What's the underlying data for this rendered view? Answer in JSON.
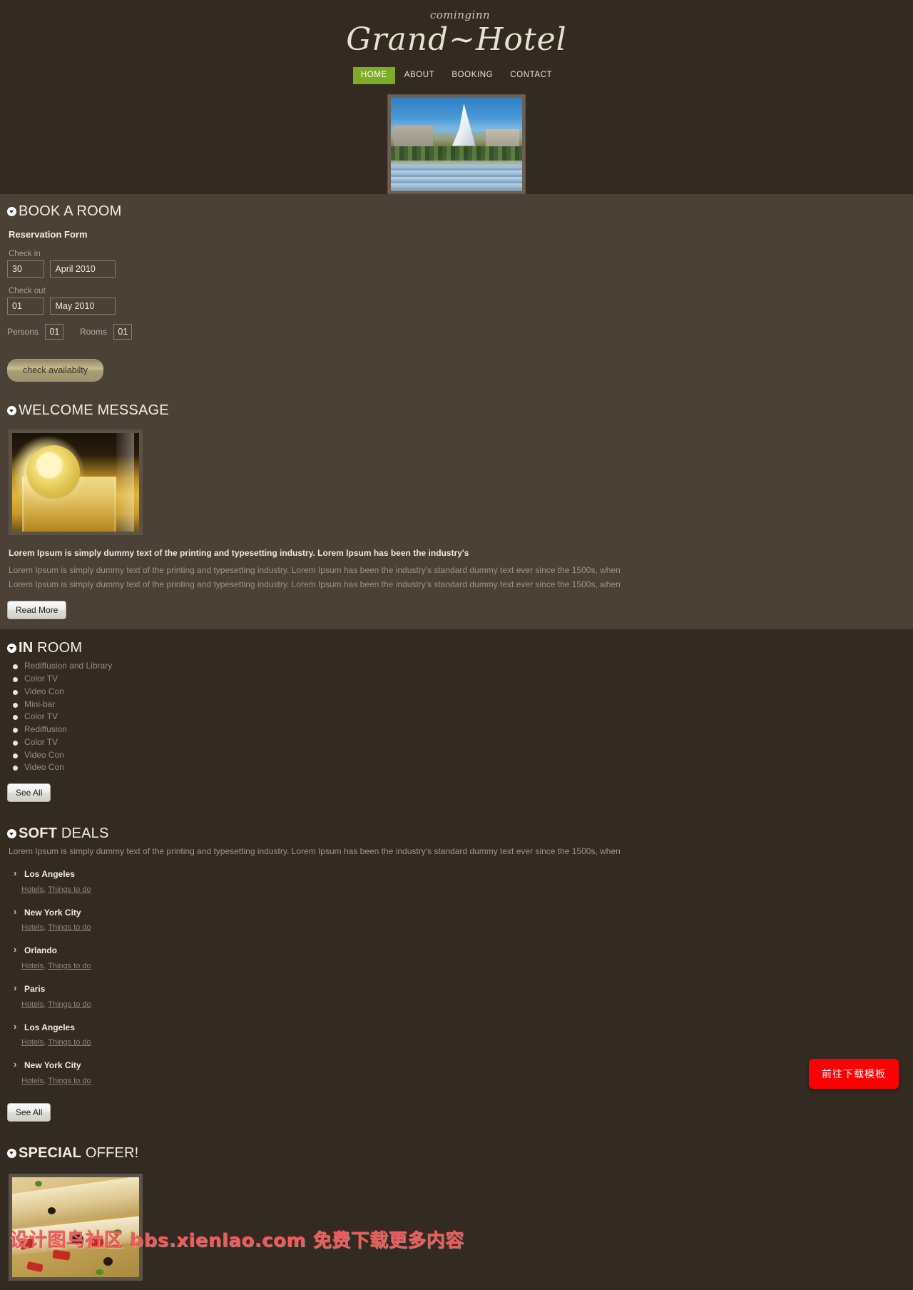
{
  "header": {
    "logo_sub": "cominginn",
    "logo_main": "Grand~Hotel",
    "hero_icon": "hotel-photo"
  },
  "nav": {
    "items": [
      {
        "label": "HOME",
        "active": true
      },
      {
        "label": "ABOUT",
        "active": false
      },
      {
        "label": "BOOKING",
        "active": false
      },
      {
        "label": "CONTACT",
        "active": false
      }
    ]
  },
  "book": {
    "title": "BOOK A ROOM",
    "form_title": "Reservation Form",
    "checkin_label": "Check in",
    "checkin_day": "30",
    "checkin_month": "April 2010",
    "checkout_label": "Check out",
    "checkout_day": "01",
    "checkout_month": "May 2010",
    "persons_label": "Persons",
    "persons_value": "01",
    "rooms_label": "Rooms",
    "rooms_value": "01",
    "submit_label": "check availabilty"
  },
  "welcome": {
    "title": "WELCOME MESSAGE",
    "image_name": "cocktail-photo",
    "lead": "Lorem Ipsum is simply dummy text of the printing and typesetting industry. Lorem Ipsum has been the industry's",
    "paragraph1": "Lorem Ipsum is simply dummy text of the printing and typesetting industry. Lorem Ipsum has been the industry's standard dummy text ever since the 1500s, when",
    "paragraph2": "Lorem Ipsum is simply dummy text of the printing and typesetting industry. Lorem Ipsum has been the industry's standard dummy text ever since the 1500s, when",
    "read_more": "Read More"
  },
  "inroom": {
    "title_bold": "IN",
    "title_light": "ROOM",
    "items": [
      "Rediffusion and Library",
      "Color TV",
      "Video Con",
      "Mini-bar",
      "Color TV",
      "Rediffusion",
      "Color TV",
      "Video Con",
      "Video Con"
    ],
    "see_all": "See All"
  },
  "deals": {
    "title_bold": "SOFT",
    "title_light": "DEALS",
    "intro": "Lorem Ipsum is simply dummy text of the printing and typesetting industry. Lorem Ipsum has been the industry's standard dummy text ever since the 1500s, when",
    "link_hotels": "Hotels",
    "link_sep": ", ",
    "link_things": "Things to do",
    "cities": [
      "Los Angeles",
      "New York City",
      "Orlando",
      "Paris",
      "Los Angeles",
      "New York City"
    ],
    "see_all": "See All"
  },
  "special": {
    "title_bold": "SPECIAL",
    "title_light": "OFFER!",
    "image_name": "pizza-photo"
  },
  "overlay": {
    "watermark": "设计图鸟社区 bbs.xienlao.com 免费下载更多内容",
    "download_button": "前往下载模板"
  },
  "colors": {
    "page_bg": "#332b22",
    "panel_bg": "#4b4136",
    "nav_active": "#7fab28",
    "download_red": "#fb0103"
  }
}
